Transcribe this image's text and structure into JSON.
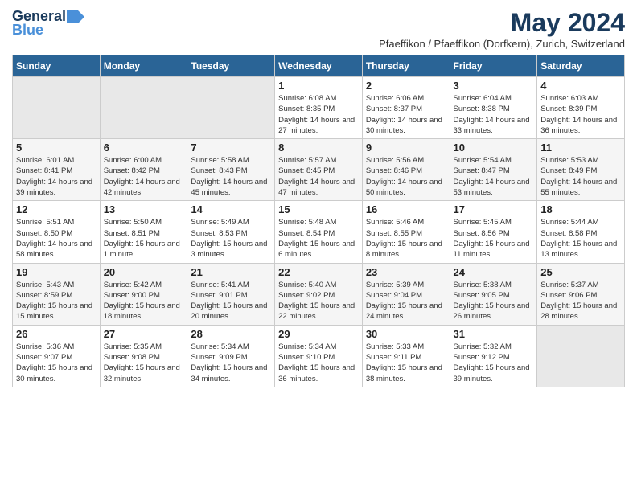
{
  "header": {
    "logo_general": "General",
    "logo_blue": "Blue",
    "month_title": "May 2024",
    "subtitle": "Pfaeffikon / Pfaeffikon (Dorfkern), Zurich, Switzerland"
  },
  "days_of_week": [
    "Sunday",
    "Monday",
    "Tuesday",
    "Wednesday",
    "Thursday",
    "Friday",
    "Saturday"
  ],
  "weeks": [
    [
      {
        "day": "",
        "info": "",
        "empty": true
      },
      {
        "day": "",
        "info": "",
        "empty": true
      },
      {
        "day": "",
        "info": "",
        "empty": true
      },
      {
        "day": "1",
        "sunrise": "Sunrise: 6:08 AM",
        "sunset": "Sunset: 8:35 PM",
        "daylight": "Daylight: 14 hours and 27 minutes."
      },
      {
        "day": "2",
        "sunrise": "Sunrise: 6:06 AM",
        "sunset": "Sunset: 8:37 PM",
        "daylight": "Daylight: 14 hours and 30 minutes."
      },
      {
        "day": "3",
        "sunrise": "Sunrise: 6:04 AM",
        "sunset": "Sunset: 8:38 PM",
        "daylight": "Daylight: 14 hours and 33 minutes."
      },
      {
        "day": "4",
        "sunrise": "Sunrise: 6:03 AM",
        "sunset": "Sunset: 8:39 PM",
        "daylight": "Daylight: 14 hours and 36 minutes."
      }
    ],
    [
      {
        "day": "5",
        "sunrise": "Sunrise: 6:01 AM",
        "sunset": "Sunset: 8:41 PM",
        "daylight": "Daylight: 14 hours and 39 minutes."
      },
      {
        "day": "6",
        "sunrise": "Sunrise: 6:00 AM",
        "sunset": "Sunset: 8:42 PM",
        "daylight": "Daylight: 14 hours and 42 minutes."
      },
      {
        "day": "7",
        "sunrise": "Sunrise: 5:58 AM",
        "sunset": "Sunset: 8:43 PM",
        "daylight": "Daylight: 14 hours and 45 minutes."
      },
      {
        "day": "8",
        "sunrise": "Sunrise: 5:57 AM",
        "sunset": "Sunset: 8:45 PM",
        "daylight": "Daylight: 14 hours and 47 minutes."
      },
      {
        "day": "9",
        "sunrise": "Sunrise: 5:56 AM",
        "sunset": "Sunset: 8:46 PM",
        "daylight": "Daylight: 14 hours and 50 minutes."
      },
      {
        "day": "10",
        "sunrise": "Sunrise: 5:54 AM",
        "sunset": "Sunset: 8:47 PM",
        "daylight": "Daylight: 14 hours and 53 minutes."
      },
      {
        "day": "11",
        "sunrise": "Sunrise: 5:53 AM",
        "sunset": "Sunset: 8:49 PM",
        "daylight": "Daylight: 14 hours and 55 minutes."
      }
    ],
    [
      {
        "day": "12",
        "sunrise": "Sunrise: 5:51 AM",
        "sunset": "Sunset: 8:50 PM",
        "daylight": "Daylight: 14 hours and 58 minutes."
      },
      {
        "day": "13",
        "sunrise": "Sunrise: 5:50 AM",
        "sunset": "Sunset: 8:51 PM",
        "daylight": "Daylight: 15 hours and 1 minute."
      },
      {
        "day": "14",
        "sunrise": "Sunrise: 5:49 AM",
        "sunset": "Sunset: 8:53 PM",
        "daylight": "Daylight: 15 hours and 3 minutes."
      },
      {
        "day": "15",
        "sunrise": "Sunrise: 5:48 AM",
        "sunset": "Sunset: 8:54 PM",
        "daylight": "Daylight: 15 hours and 6 minutes."
      },
      {
        "day": "16",
        "sunrise": "Sunrise: 5:46 AM",
        "sunset": "Sunset: 8:55 PM",
        "daylight": "Daylight: 15 hours and 8 minutes."
      },
      {
        "day": "17",
        "sunrise": "Sunrise: 5:45 AM",
        "sunset": "Sunset: 8:56 PM",
        "daylight": "Daylight: 15 hours and 11 minutes."
      },
      {
        "day": "18",
        "sunrise": "Sunrise: 5:44 AM",
        "sunset": "Sunset: 8:58 PM",
        "daylight": "Daylight: 15 hours and 13 minutes."
      }
    ],
    [
      {
        "day": "19",
        "sunrise": "Sunrise: 5:43 AM",
        "sunset": "Sunset: 8:59 PM",
        "daylight": "Daylight: 15 hours and 15 minutes."
      },
      {
        "day": "20",
        "sunrise": "Sunrise: 5:42 AM",
        "sunset": "Sunset: 9:00 PM",
        "daylight": "Daylight: 15 hours and 18 minutes."
      },
      {
        "day": "21",
        "sunrise": "Sunrise: 5:41 AM",
        "sunset": "Sunset: 9:01 PM",
        "daylight": "Daylight: 15 hours and 20 minutes."
      },
      {
        "day": "22",
        "sunrise": "Sunrise: 5:40 AM",
        "sunset": "Sunset: 9:02 PM",
        "daylight": "Daylight: 15 hours and 22 minutes."
      },
      {
        "day": "23",
        "sunrise": "Sunrise: 5:39 AM",
        "sunset": "Sunset: 9:04 PM",
        "daylight": "Daylight: 15 hours and 24 minutes."
      },
      {
        "day": "24",
        "sunrise": "Sunrise: 5:38 AM",
        "sunset": "Sunset: 9:05 PM",
        "daylight": "Daylight: 15 hours and 26 minutes."
      },
      {
        "day": "25",
        "sunrise": "Sunrise: 5:37 AM",
        "sunset": "Sunset: 9:06 PM",
        "daylight": "Daylight: 15 hours and 28 minutes."
      }
    ],
    [
      {
        "day": "26",
        "sunrise": "Sunrise: 5:36 AM",
        "sunset": "Sunset: 9:07 PM",
        "daylight": "Daylight: 15 hours and 30 minutes."
      },
      {
        "day": "27",
        "sunrise": "Sunrise: 5:35 AM",
        "sunset": "Sunset: 9:08 PM",
        "daylight": "Daylight: 15 hours and 32 minutes."
      },
      {
        "day": "28",
        "sunrise": "Sunrise: 5:34 AM",
        "sunset": "Sunset: 9:09 PM",
        "daylight": "Daylight: 15 hours and 34 minutes."
      },
      {
        "day": "29",
        "sunrise": "Sunrise: 5:34 AM",
        "sunset": "Sunset: 9:10 PM",
        "daylight": "Daylight: 15 hours and 36 minutes."
      },
      {
        "day": "30",
        "sunrise": "Sunrise: 5:33 AM",
        "sunset": "Sunset: 9:11 PM",
        "daylight": "Daylight: 15 hours and 38 minutes."
      },
      {
        "day": "31",
        "sunrise": "Sunrise: 5:32 AM",
        "sunset": "Sunset: 9:12 PM",
        "daylight": "Daylight: 15 hours and 39 minutes."
      },
      {
        "day": "",
        "info": "",
        "empty": true
      }
    ]
  ]
}
